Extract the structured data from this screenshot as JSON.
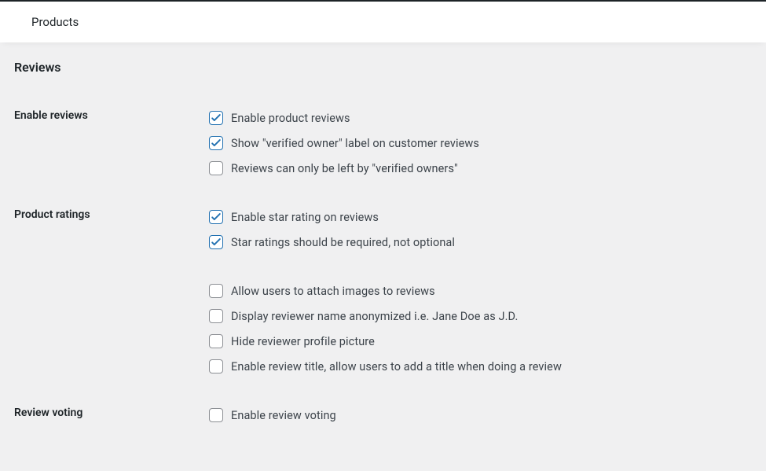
{
  "header": {
    "title": "Products"
  },
  "section_heading": "Reviews",
  "groups": {
    "enable_reviews": {
      "label": "Enable reviews",
      "items": [
        {
          "label": "Enable product reviews",
          "checked": true
        },
        {
          "label": "Show \"verified owner\" label on customer reviews",
          "checked": true
        },
        {
          "label": "Reviews can only be left by \"verified owners\"",
          "checked": false
        }
      ]
    },
    "product_ratings": {
      "label": "Product ratings",
      "items": [
        {
          "label": "Enable star rating on reviews",
          "checked": true
        },
        {
          "label": "Star ratings should be required, not optional",
          "checked": true
        }
      ],
      "extra": [
        {
          "label": "Allow users to attach images to reviews",
          "checked": false
        },
        {
          "label": "Display reviewer name anonymized i.e. Jane Doe as J.D.",
          "checked": false
        },
        {
          "label": "Hide reviewer profile picture",
          "checked": false
        },
        {
          "label": "Enable review title, allow users to add a title when doing a review",
          "checked": false
        }
      ]
    },
    "review_voting": {
      "label": "Review voting",
      "items": [
        {
          "label": "Enable review voting",
          "checked": false
        }
      ]
    }
  }
}
